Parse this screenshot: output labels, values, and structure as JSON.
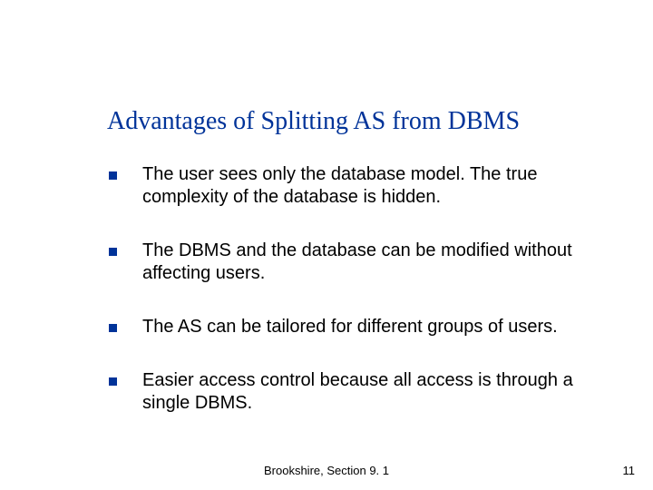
{
  "title": "Advantages of Splitting AS from DBMS",
  "bullets": [
    "The user sees only the database model. The true complexity of the database is hidden.",
    "The DBMS and the database can be modified without affecting users.",
    "The AS can be tailored for different groups of users.",
    "Easier access control because all access is through a single DBMS."
  ],
  "footer": "Brookshire, Section 9. 1",
  "page_number": "11"
}
